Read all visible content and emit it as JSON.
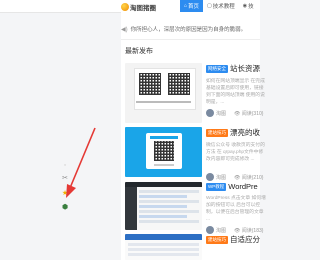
{
  "header": {
    "logo_text": "淘图猪圈",
    "nav": [
      {
        "label": "首页",
        "icon": "home-icon",
        "glyph": "⌂",
        "active": true
      },
      {
        "label": "技术教程",
        "icon": "document-icon",
        "glyph": "▢",
        "active": false
      },
      {
        "label": "技",
        "icon": "user-icon",
        "glyph": "◉",
        "active": false
      }
    ]
  },
  "notice": {
    "text": "你所担心人，深层次的原因是因为自身的脆弱。"
  },
  "section": {
    "title": "最新发布"
  },
  "posts": [
    {
      "tag": "网络安全",
      "tag_color": "#2d8cf0",
      "title": "站长资源",
      "excerpt": "如何在网站顶端显示 在完成基础设置后即可使用，链接到下面的网站顶端 使用的说明是，...",
      "author": "淘图",
      "views": "阅读(310)"
    },
    {
      "tag": "建站技巧",
      "tag_color": "#ff7a18",
      "title": "漂亮的收",
      "excerpt": "微信公众号 收款页的支付的方法 在 qrpay.php文件中修改内容即可完成修改 ...",
      "author": "淘图",
      "views": "阅读(210)"
    },
    {
      "tag": "WP教程",
      "tag_color": "#2d8cf0",
      "title": "WordPre",
      "excerpt": "WordPress 点击文章 如何增加的按钮可以 后台可以控制，以便在后台管理的文章 ...",
      "author": "淘图",
      "views": "阅读(183)"
    },
    {
      "tag": "建站技巧",
      "tag_color": "#ff7a18",
      "title": "自适应分",
      "excerpt": "",
      "author": "",
      "views": ""
    }
  ],
  "sidebar_icons": [
    {
      "name": "file-icon",
      "glyph": "▫",
      "color": "#cfcfcf"
    },
    {
      "name": "tools-icon",
      "glyph": "✂",
      "color": "#888"
    },
    {
      "name": "star-icon",
      "glyph": "★",
      "color": "#f1b000"
    },
    {
      "name": "shield-icon",
      "glyph": "⬢",
      "color": "#3a7f3f"
    }
  ],
  "colors": {
    "accent": "#2d8cf0",
    "arrow": "#e53935"
  }
}
